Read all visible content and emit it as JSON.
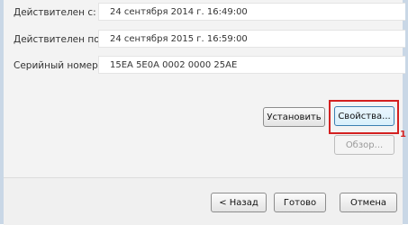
{
  "fields": [
    {
      "label": "Действителен с:",
      "value": "24 сентября 2014 г. 16:49:00"
    },
    {
      "label": "Действителен по:",
      "value": "24 сентября 2015 г. 16:59:00"
    },
    {
      "label": "Серийный номер:",
      "value": "15EA 5E0A 0002 0000 25AE"
    }
  ],
  "buttons": {
    "install": "Установить",
    "properties": "Свойства...",
    "browse": "Обзор..."
  },
  "footer": {
    "back": "< Назад",
    "finish": "Готово",
    "cancel": "Отмена"
  },
  "annotation": "1",
  "colors": {
    "highlight": "#d42020",
    "field_bg": "#ffffff",
    "dialog_bg": "#f3f3f3"
  }
}
